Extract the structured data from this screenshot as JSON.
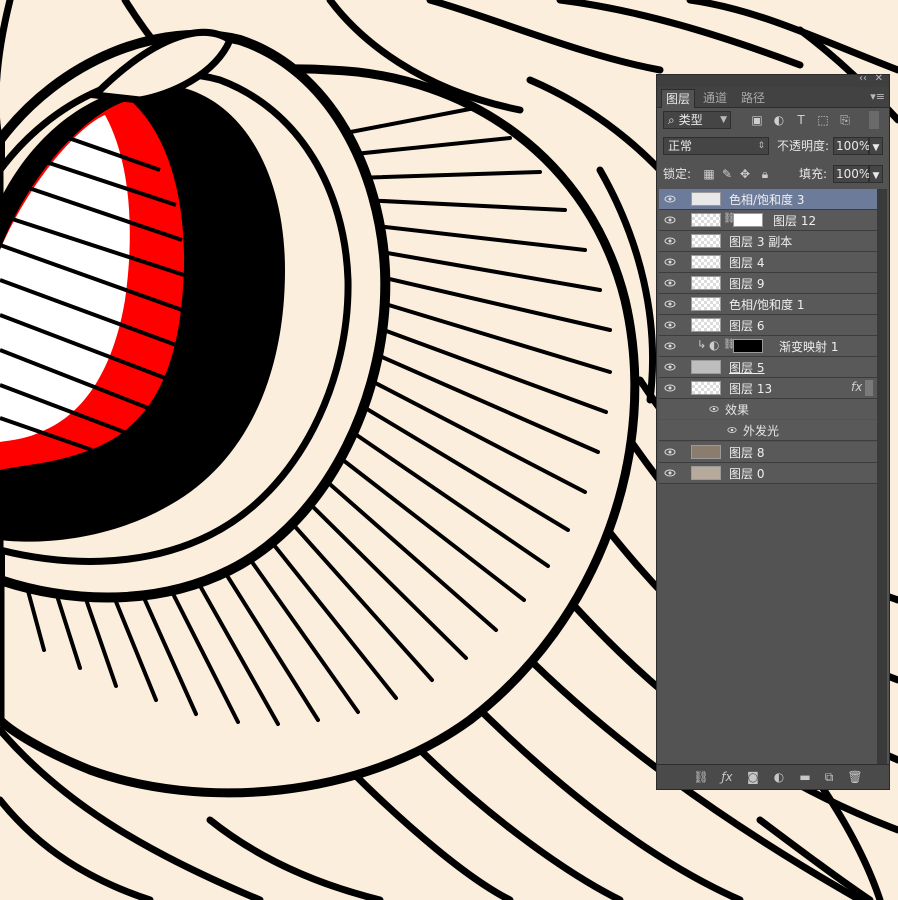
{
  "panel": {
    "tabs": [
      "图层",
      "通道",
      "路径"
    ],
    "active_tab": 0,
    "filter_kind": "类型",
    "blend_mode": "正常",
    "opacity_label": "不透明度:",
    "opacity_value": "100%",
    "lock_label": "锁定:",
    "fill_label": "填充:",
    "fill_value": "100%"
  },
  "layers": [
    {
      "name": "色相/饱和度 3",
      "selected": true
    },
    {
      "name": "图层 12",
      "has_mask": true
    },
    {
      "name": "图层 3 副本"
    },
    {
      "name": "图层 4"
    },
    {
      "name": "图层 9"
    },
    {
      "name": "色相/饱和度 1"
    },
    {
      "name": "图层 6"
    },
    {
      "name": "渐变映射 1",
      "adjustment": true
    },
    {
      "name": "图层 5"
    },
    {
      "name": "图层 13",
      "fx": "fx"
    },
    {
      "name": "效果",
      "effect_header": true
    },
    {
      "name": "外发光",
      "effect": true
    },
    {
      "name": "图层 8"
    },
    {
      "name": "图层 0"
    }
  ],
  "colors": {
    "canvas_bg": "#fbeedd",
    "ink": "#000000",
    "accent_red": "#ff0000",
    "panel_bg": "#535353",
    "selected_row": "#6d7b9a"
  },
  "icons": {
    "filter": "search-icon",
    "eye": "eye-icon",
    "link": "link-icon",
    "fx": "fx-icon",
    "mask": "mask-icon",
    "adjustment": "adjustment-icon",
    "folder": "folder-icon",
    "new": "new-layer-icon",
    "trash": "trash-icon"
  }
}
